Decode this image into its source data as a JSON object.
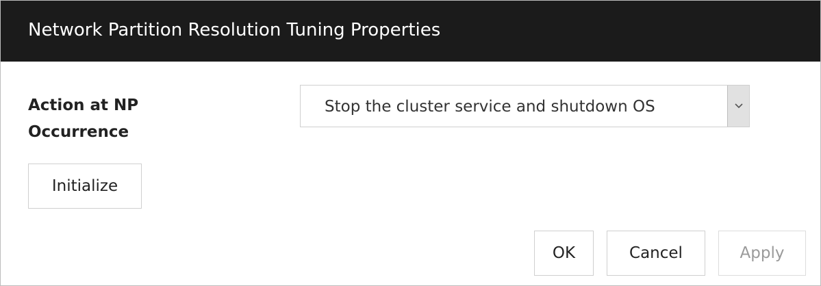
{
  "dialog": {
    "title": "Network Partition Resolution Tuning Properties"
  },
  "form": {
    "action_label": "Action at NP Occurrence",
    "action_selected": "Stop the cluster service and shutdown OS"
  },
  "buttons": {
    "initialize": "Initialize",
    "ok": "OK",
    "cancel": "Cancel",
    "apply": "Apply"
  },
  "icons": {
    "dropdown": "chevron-down-icon"
  },
  "colors": {
    "titlebar": "#1b1b1b",
    "title_text": "#ffffff",
    "disabled_text": "#9a9a9a"
  }
}
